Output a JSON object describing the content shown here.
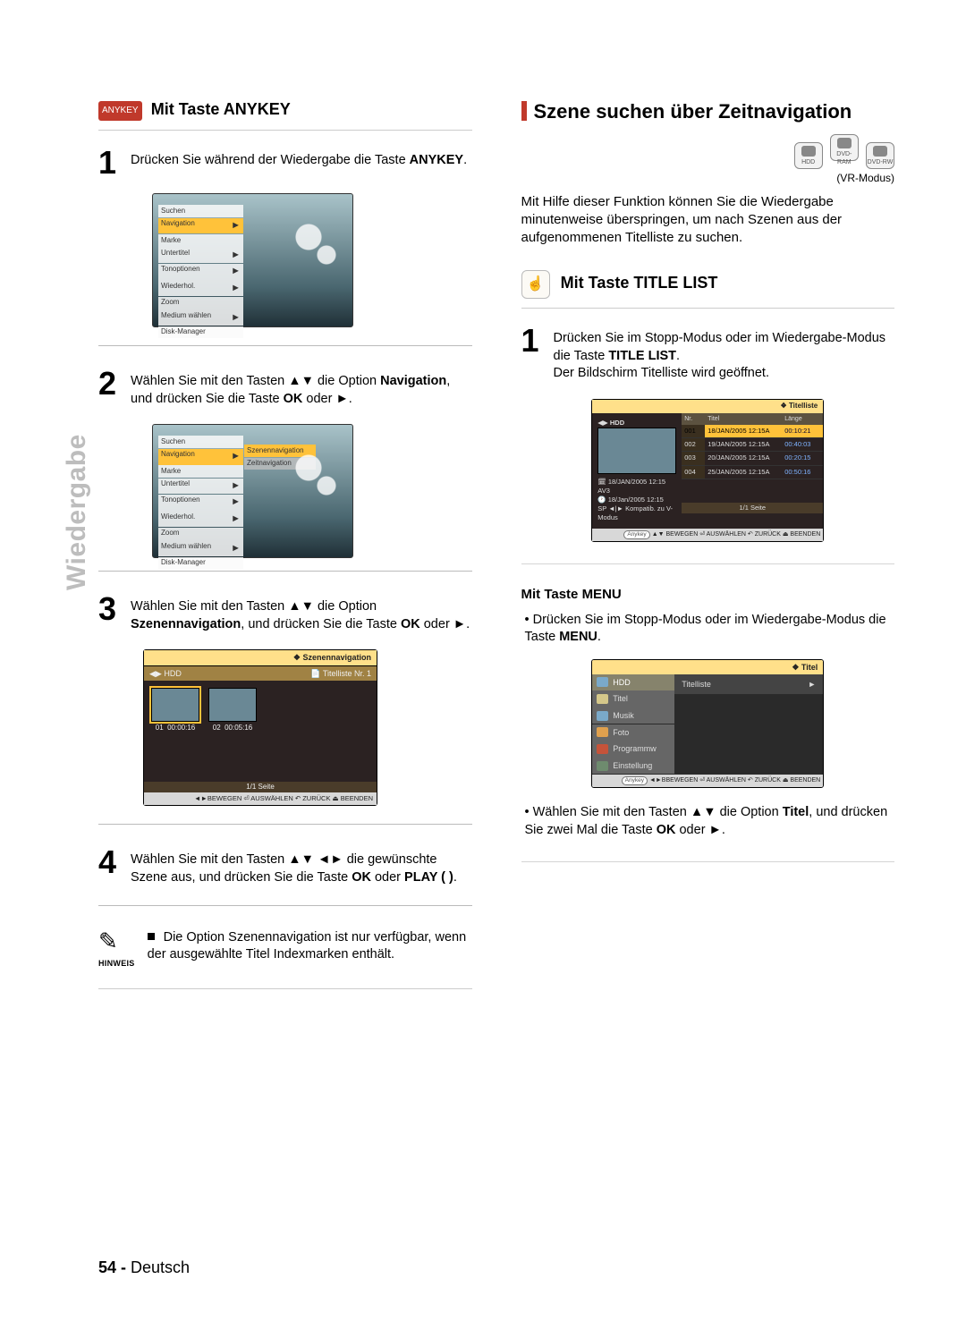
{
  "side_tab": "Wiedergabe",
  "left": {
    "anykey_badge": "ANYKEY",
    "heading": "Mit Taste ANYKEY",
    "step1": {
      "num": "1",
      "text_a": "Drücken Sie während der Wiedergabe die Taste ",
      "bold": "ANYKEY",
      "text_b": "."
    },
    "osd_menu": [
      "Suchen",
      "Navigation",
      "Marke",
      "Untertitel",
      "Tonoptionen",
      "Wiederhol.",
      "Zoom",
      "Medium wählen",
      "Disk-Manager"
    ],
    "step2": {
      "num": "2",
      "text_a": "Wählen Sie mit den Tasten ▲▼ die Option ",
      "bold": "Navigation",
      "text_b": ", und drücken Sie die Taste ",
      "bold2": "OK",
      "text_c": " oder ►."
    },
    "osd_sub": [
      "Szenennavigation",
      "Zeitnavigation"
    ],
    "step3": {
      "num": "3",
      "text_a": "Wählen Sie mit den Tasten ▲▼ die Option ",
      "bold": "Szenennavigation",
      "text_b": ", und drücken Sie die Taste ",
      "bold2": "OK",
      "text_c": " oder ►."
    },
    "scene": {
      "title_mark": "❖  Szenennavigation",
      "hdd_row_left": "HDD",
      "hdd_row_right": "Titelliste Nr. 1",
      "thumb1": {
        "no": "01",
        "t": "00:00:16"
      },
      "thumb2": {
        "no": "02",
        "t": "00:05:16"
      },
      "page_label": "1/1 Seite",
      "footer": "◄►BEWEGEN  ⏎ AUSWÄHLEN  ↶ ZURÜCK  ⏏ BEENDEN"
    },
    "step4": {
      "num": "4",
      "text_a": "Wählen Sie mit den Tasten ▲▼ ◄► die gewünschte Szene aus, und drücken Sie die Taste ",
      "bold": "OK",
      "text_b": " oder ",
      "bold2": "PLAY (      )",
      "text_c": "."
    },
    "note": {
      "label": "HINWEIS",
      "text": "Die Option Szenennavigation ist nur verfügbar, wenn der ausgewählte Titel Indexmarken enthält."
    }
  },
  "right": {
    "main_heading": "Szene suchen über Zeitnavigation",
    "discs": [
      "HDD",
      "DVD-RAM",
      "DVD-RW"
    ],
    "vr_note": "(VR-Modus)",
    "intro": "Mit Hilfe dieser Funktion können Sie die Wiedergabe minutenweise überspringen, um nach Szenen aus der aufgenommenen Titelliste zu suchen.",
    "tl_icon": "☝",
    "tl_heading": "Mit Taste TITLE LIST",
    "step1": {
      "num": "1",
      "text_a": "Drücken Sie im Stopp-Modus oder im Wiedergabe-Modus die Taste ",
      "bold": "TITLE LIST",
      "text_b": ".",
      "text_c": "Der Bildschirm Titelliste wird geöffnet."
    },
    "titlelist": {
      "top": "❖   Titelliste",
      "hdd": "HDD",
      "head": {
        "a": "Nr.",
        "b": "Titel",
        "c": "Länge"
      },
      "rows": [
        {
          "no": "001",
          "t": "18/JAN/2005 12:15A",
          "len": "00:10:21"
        },
        {
          "no": "002",
          "t": "19/JAN/2005 12:15A",
          "len": "00:40:03"
        },
        {
          "no": "003",
          "t": "20/JAN/2005 12:15A",
          "len": "00:20:15"
        },
        {
          "no": "004",
          "t": "25/JAN/2005 12:15A",
          "len": "00:50:16"
        }
      ],
      "meta1": "18/JAN/2005 12:15 AV3",
      "meta2": "18/Jan/2005 12:15",
      "meta3": "SP ◄|► Kompatib. zu V-Modus",
      "page": "1/1 Seite",
      "footer_pill": "Anykey",
      "footer": "▲▼ BEWEGEN  ⏎ AUSWÄHLEN  ↶ ZURÜCK  ⏏ BEENDEN"
    },
    "menu_heading": "Mit Taste MENU",
    "menu_bullet_a": "Drücken Sie im Stopp-Modus oder im Wiedergabe-Modus die Taste ",
    "menu_bold": "MENU",
    "menu_bullet_b": ".",
    "titlepanel": {
      "top": "❖   Titel",
      "items": [
        {
          "cls": "hdd",
          "label": "HDD"
        },
        {
          "cls": "tit",
          "label": "Titel"
        },
        {
          "cls": "mus",
          "label": "Musik"
        },
        {
          "cls": "fot",
          "label": "Foto"
        },
        {
          "cls": "prg",
          "label": "Programmw"
        },
        {
          "cls": "ein",
          "label": "Einstellung"
        }
      ],
      "sel": "Titelliste",
      "footer_pill": "Anykey",
      "footer": "◄►BBEWEGEN  ⏎ AUSWÄHLEN  ↶ ZURÜCK  ⏏ BEENDEN"
    },
    "second_bullet_a": "Wählen Sie mit den Tasten ▲▼ die Option ",
    "second_bold": "Titel",
    "second_bullet_b": ", und drücken Sie zwei Mal die Taste ",
    "second_bold2": "OK",
    "second_bullet_c": " oder ►."
  },
  "footer": {
    "page": "54 - ",
    "lang": "Deutsch"
  }
}
